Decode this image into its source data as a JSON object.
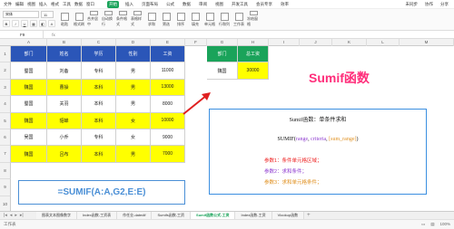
{
  "menubar": {
    "items": [
      "文件",
      "编辑",
      "视图",
      "插入",
      "格式",
      "工具",
      "数据",
      "窗口"
    ],
    "tabs": [
      "开始",
      "插入",
      "页面布局",
      "公式",
      "数据",
      "审阅",
      "视图",
      "开发工具",
      "会员专享",
      "效率"
    ],
    "active_tab": "开始",
    "right": [
      "未同步",
      "协作",
      "分享"
    ]
  },
  "ribbon": {
    "font_name": "宋体",
    "font_size": "11",
    "big_buttons": [
      "粘贴",
      "格式刷",
      "合并居中",
      "自动换行",
      "条件格式",
      "表格样式",
      "求和",
      "筛选",
      "排序",
      "填充",
      "单元格",
      "行和列",
      "工作表",
      "冻结窗格"
    ]
  },
  "formulabar": {
    "cell_ref": "F9",
    "fx": "fx"
  },
  "columns": [
    "A",
    "B",
    "C",
    "D",
    "E",
    "F",
    "G",
    "H",
    "I",
    "J",
    "K",
    "L",
    "M"
  ],
  "rows": [
    "1",
    "2",
    "3",
    "4",
    "5",
    "6",
    "7",
    "8",
    "9",
    "10",
    "11"
  ],
  "table": {
    "headers": [
      "部门",
      "姓名",
      "学历",
      "性别",
      "工资"
    ],
    "rows": [
      [
        "蜀国",
        "刘备",
        "专科",
        "男",
        "11000"
      ],
      [
        "魏国",
        "曹操",
        "本科",
        "男",
        "13000"
      ],
      [
        "蜀国",
        "关羽",
        "本科",
        "男",
        "8000"
      ],
      [
        "魏国",
        "貂蝉",
        "本科",
        "女",
        "10000"
      ],
      [
        "吴国",
        "小乔",
        "专科",
        "女",
        "9000"
      ],
      [
        "魏国",
        "吕布",
        "本科",
        "男",
        "7000"
      ]
    ]
  },
  "result_table": {
    "headers": [
      "部门",
      "总工资"
    ],
    "dept": "魏国",
    "total": "30000"
  },
  "formula_text": "=SUMIF(A:A,G2,E:E)",
  "title": "Sumif函数",
  "info": {
    "line1": "Sumif函数：单条件求和",
    "syntax_prefix": "SUMIF(",
    "syntax_range": "range",
    "syntax_sep1": ", ",
    "syntax_criteria": "criteria",
    "syntax_sep2": ", ",
    "syntax_sum": "[sum_range]",
    "syntax_suffix": ")",
    "param1": "参数1：条件单元格区域；",
    "param2": "参数2：求和条件；",
    "param3": "参数3：求和单元格条件；"
  },
  "sheet_tabs": [
    "图表文本图像数字",
    "Index函数-工资表",
    "作任业-datedif",
    "Sumifs函数-工资",
    "Sumif函数公式-工资",
    "Index函数-工资",
    "Vlookup函数"
  ],
  "active_sheet": "Sumif函数公式-工资",
  "status": {
    "left": "工作表",
    "zoom": "100%"
  },
  "colors": {
    "header_blue": "#2b56b8",
    "highlight": "#ffff00",
    "result_header": "#1aa35a",
    "title_pink": "#ff2d7a",
    "accent_blue": "#4a8fd6"
  }
}
